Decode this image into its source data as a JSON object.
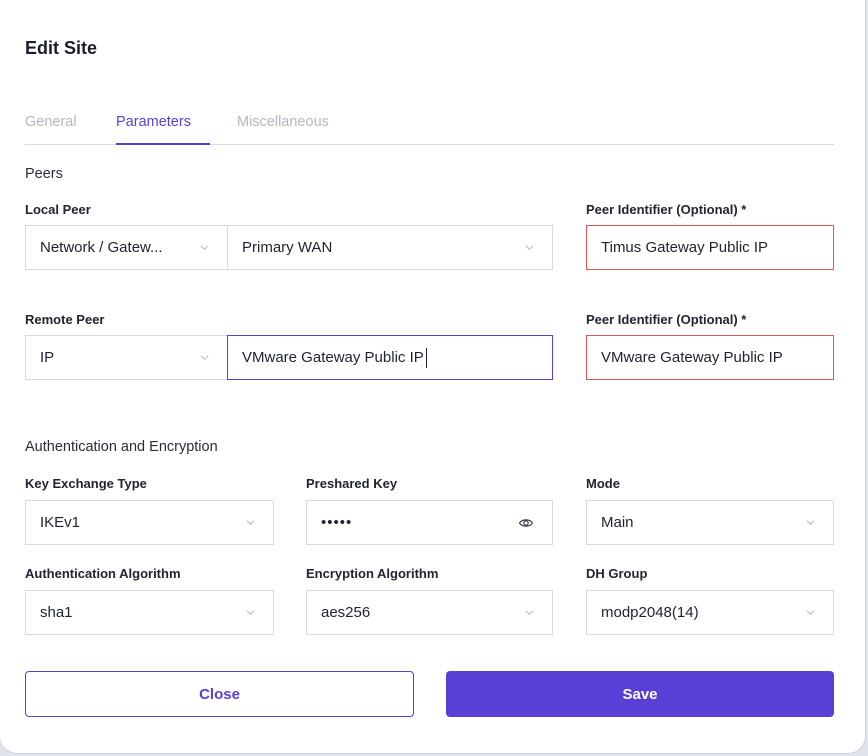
{
  "dialog": {
    "title": "Edit Site"
  },
  "tabs": [
    {
      "label": "General",
      "active": false
    },
    {
      "label": "Parameters",
      "active": true
    },
    {
      "label": "Miscellaneous",
      "active": false
    }
  ],
  "peers": {
    "section_title": "Peers",
    "local_peer": {
      "label": "Local Peer",
      "type_value": "Network / Gatew...",
      "interface_value": "Primary WAN",
      "identifier_label": "Peer Identifier (Optional) *",
      "identifier_value": "Timus Gateway Public IP"
    },
    "remote_peer": {
      "label": "Remote Peer",
      "type_value": "IP",
      "address_value": "VMware Gateway Public IP",
      "identifier_label": "Peer Identifier (Optional) *",
      "identifier_value": "VMware Gateway Public IP"
    }
  },
  "auth": {
    "section_title": "Authentication and Encryption",
    "key_exchange": {
      "label": "Key Exchange Type",
      "value": "IKEv1"
    },
    "preshared_key": {
      "label": "Preshared Key",
      "value": "•••••"
    },
    "mode": {
      "label": "Mode",
      "value": "Main"
    },
    "auth_algorithm": {
      "label": "Authentication Algorithm",
      "value": "sha1"
    },
    "enc_algorithm": {
      "label": "Encryption Algorithm",
      "value": "aes256"
    },
    "dh_group": {
      "label": "DH Group",
      "value": "modp2048(14)"
    }
  },
  "actions": {
    "close_label": "Close",
    "save_label": "Save"
  },
  "colors": {
    "accent": "#5a3fd6",
    "error": "#e05757",
    "border": "#d6dae2"
  },
  "icons": {
    "dropdown": "chevron-down-icon",
    "reveal": "eye-icon"
  }
}
